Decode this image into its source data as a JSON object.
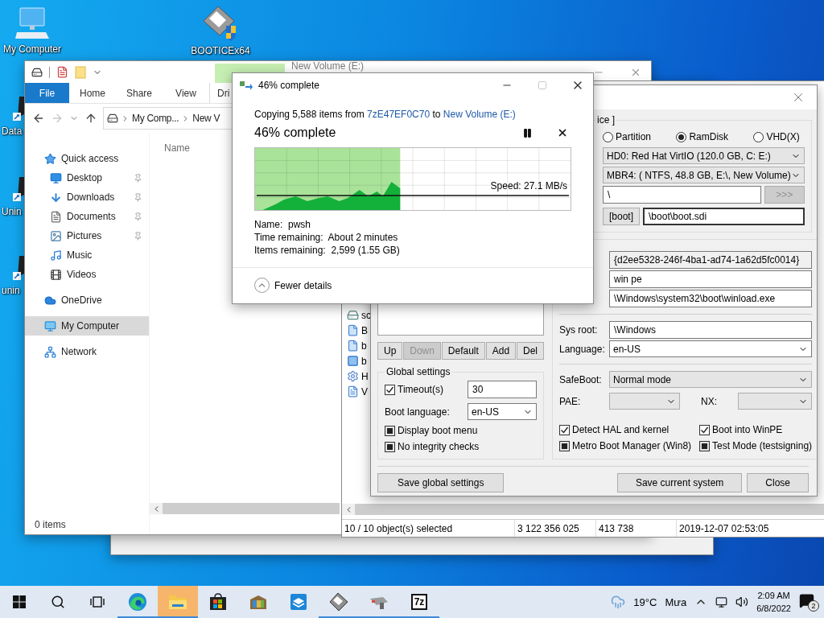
{
  "desktop_icons": [
    {
      "label": "My Computer",
      "kind": "computer"
    },
    {
      "label": "BOOTICEx64",
      "kind": "bootice"
    },
    {
      "label": "Data",
      "kind": "shortcut"
    },
    {
      "label": "Unin",
      "kind": "shortcut"
    },
    {
      "label": "unin",
      "kind": "shortcut"
    }
  ],
  "explorer": {
    "title": "New Volume (E:)",
    "ribbon_tabs": [
      {
        "label": "File",
        "kind": "file"
      },
      {
        "label": "Home",
        "kind": "tab"
      },
      {
        "label": "Share",
        "kind": "tab"
      },
      {
        "label": "View",
        "kind": "tab"
      },
      {
        "label": "Dri",
        "kind": "context"
      }
    ],
    "breadcrumb": [
      "My Comp...",
      "New V"
    ],
    "nav": [
      {
        "label": "Quick access",
        "kind": "star",
        "selected": false,
        "children": [
          {
            "label": "Desktop",
            "kind": "desktop",
            "selected": false,
            "pinned": true
          },
          {
            "label": "Downloads",
            "kind": "download",
            "selected": false,
            "pinned": true
          },
          {
            "label": "Documents",
            "kind": "document",
            "selected": false,
            "pinned": true
          },
          {
            "label": "Pictures",
            "kind": "picture",
            "selected": false,
            "pinned": true
          },
          {
            "label": "Music",
            "kind": "music",
            "selected": false,
            "pinned": false
          },
          {
            "label": "Videos",
            "kind": "video",
            "selected": false,
            "pinned": false
          }
        ]
      },
      {
        "label": "OneDrive",
        "kind": "cloud",
        "selected": false
      },
      {
        "label": "My Computer",
        "kind": "computer",
        "selected": true
      },
      {
        "label": "Network",
        "kind": "network",
        "selected": false
      }
    ],
    "column": "Name",
    "status": "0 items"
  },
  "archive_window": {
    "list_items": [
      {
        "label": "sc",
        "kind": "drive"
      },
      {
        "label": "B",
        "kind": "file"
      },
      {
        "label": "b",
        "kind": "file"
      },
      {
        "label": "b",
        "kind": "app"
      },
      {
        "label": "H",
        "kind": "settings"
      },
      {
        "label": "V",
        "kind": "text"
      }
    ],
    "status": [
      "10 / 10 object(s) selected",
      "3 122 356 025",
      "413 738",
      "2019-12-07 02:53:05"
    ]
  },
  "bootice": {
    "group_label": "ice ]",
    "targets": [
      {
        "label": "Partition",
        "selected": false
      },
      {
        "label": "RamDisk",
        "selected": true
      },
      {
        "label": "VHD(X)",
        "selected": false
      }
    ],
    "disk": "HD0: Red Hat VirtIO (120.0 GB, C: E:)",
    "partition": "MBR4: ( NTFS,  48.8 GB, E:\\, New Volume)",
    "path": "\\",
    "browse_button": {
      "label": ">>>",
      "disabled": true
    },
    "sdi_button": "[boot]",
    "sdi_path": "\\boot\\boot.sdi",
    "entry_id": "{d2ee5328-246f-4ba1-ad74-1a62d5fc0014}",
    "entry_title": "win pe",
    "boot_file": "\\Windows\\system32\\boot\\winload.exe",
    "sys_root_label": "Sys root:",
    "sys_root": "\\Windows",
    "language_label": "Language:",
    "language": "en-US",
    "safeboot_label": "SafeBoot:",
    "safeboot": "Normal mode",
    "pae_label": "PAE:",
    "nx_label": "NX:",
    "options": [
      {
        "label": "Detect HAL and kernel",
        "checked": true,
        "mixed": false
      },
      {
        "label": "Boot into WinPE",
        "checked": true,
        "mixed": false
      },
      {
        "label": "Metro Boot Manager (Win8)",
        "checked": false,
        "mixed": true
      },
      {
        "label": "Test Mode (testsigning)",
        "checked": false,
        "mixed": true
      }
    ],
    "list_buttons": [
      {
        "label": "Up",
        "disabled": false
      },
      {
        "label": "Down",
        "disabled": true
      },
      {
        "label": "Default",
        "disabled": false
      },
      {
        "label": "Add",
        "disabled": false
      },
      {
        "label": "Del",
        "disabled": false
      }
    ],
    "global": {
      "title": "Global settings",
      "timeout": {
        "label": "Timeout(s)",
        "checked": true,
        "mixed": false,
        "value": "30"
      },
      "boot_language_label": "Boot language:",
      "boot_language": "en-US",
      "options": [
        {
          "label": "Display boot menu",
          "checked": false,
          "mixed": true
        },
        {
          "label": "No integrity checks",
          "checked": false,
          "mixed": true
        }
      ]
    },
    "footer_buttons": [
      {
        "label": "Save global settings",
        "kind": "left"
      },
      {
        "label": "Save current system",
        "kind": "right"
      },
      {
        "label": "Close",
        "kind": "right"
      }
    ]
  },
  "copy_dialog": {
    "title": "46% complete",
    "summary": {
      "prefix": "Copying 5,588 items from",
      "source": "7zE47EF0C70",
      "middle": "to",
      "destination": "New Volume (E:)"
    },
    "heading": "46% complete",
    "level": 0.46,
    "speed": "Speed: 27.1 MB/s",
    "details": [
      {
        "label": "Name:",
        "value": "pwsh"
      },
      {
        "label": "Time remaining:",
        "value": "About 2 minutes"
      },
      {
        "label": "Items remaining:",
        "value": "2,599 (1.55 GB)"
      }
    ],
    "toggle": "Fewer details"
  },
  "taskbar": {
    "apps": [
      {
        "kind": "edge",
        "running": true,
        "attention": false
      },
      {
        "kind": "folder",
        "running": true,
        "attention": true
      },
      {
        "kind": "store",
        "running": false,
        "attention": false
      },
      {
        "kind": "archive",
        "running": false,
        "attention": false
      },
      {
        "kind": "box",
        "running": false,
        "attention": false
      },
      {
        "kind": "bootice",
        "running": true,
        "attention": false
      },
      {
        "kind": "tool",
        "running": true,
        "attention": false
      },
      {
        "kind": "sevenzip",
        "label": "7z",
        "running": true,
        "attention": false
      }
    ],
    "temperature": "19°C",
    "weather": "Mưa",
    "time": "2:09 AM",
    "date": "6/8/2022",
    "notifications": "2"
  }
}
